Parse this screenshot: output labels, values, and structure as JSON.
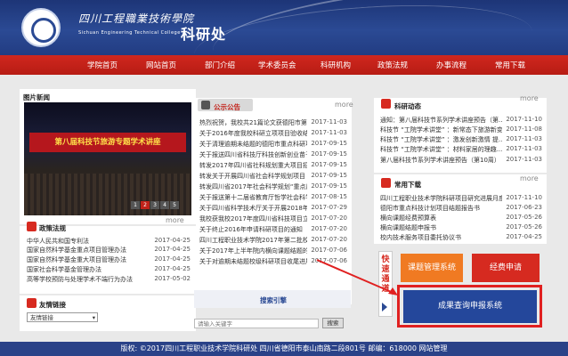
{
  "header": {
    "school_name_cn": "四川工程職業技術學院",
    "school_name_en": "Sichuan Engineering Technical College",
    "dept": "科研处"
  },
  "nav": [
    "学院首页",
    "网站首页",
    "部门介绍",
    "学术委员会",
    "科研机构",
    "政策法规",
    "办事流程",
    "常用下载"
  ],
  "photo_news": {
    "title": "图片新闻",
    "banner": "第八届科技节旅游专题学术讲座",
    "pages": [
      "1",
      "2",
      "3",
      "4",
      "5"
    ],
    "active_page": "2"
  },
  "policy": {
    "title": "政策法规",
    "more": "more",
    "items": [
      {
        "t": "中华人民共和国专利法",
        "d": "2017-04-25"
      },
      {
        "t": "国家自然科学基金重点项目管理办法",
        "d": "2017-04-25"
      },
      {
        "t": "国家自然科学基金重大项目管理办法",
        "d": "2017-04-25"
      },
      {
        "t": "国家社会科学基金管理办法",
        "d": "2017-04-25"
      },
      {
        "t": "高等学校预防与处理学术不端行为办法",
        "d": "2017-05-02"
      }
    ]
  },
  "links": {
    "title": "友情链接",
    "select_value": "友情链接"
  },
  "notice": {
    "title": "公示公告",
    "more": "more",
    "items": [
      {
        "t": "热烈祝贺，我校共21篇论文获德阳市第十六届...",
        "d": "2017-11-03"
      },
      {
        "t": "关于2016年度我校科研立项项目验收结题的通知",
        "d": "2017-11-03"
      },
      {
        "t": "关于清理逾期未结题的德阳市重点科研项目的通知",
        "d": "2017-09-15"
      },
      {
        "t": "关于报送四川省科技厅科技创新创业苗子工程项目",
        "d": "2017-09-15"
      },
      {
        "t": "转发2017年四川省社科规划重大项目招标公告",
        "d": "2017-09-15"
      },
      {
        "t": "转发关于开展四川省社会科学规划项目（首批...",
        "d": "2017-09-15"
      },
      {
        "t": "转发四川省2017年社会科学规划“重点后期资助...",
        "d": "2017-09-15"
      },
      {
        "t": "关于报送第十二届省教育厅哲学社会科学研究优...",
        "d": "2017-08-15"
      },
      {
        "t": "关于四川省科学技术厅关于开展2018年度科技项目",
        "d": "2017-07-29"
      },
      {
        "t": "我校获我校2017年度四川省科技项目立项通知",
        "d": "2017-07-20"
      },
      {
        "t": "关于终止2016年申请科研项目的通知",
        "d": "2017-07-20"
      },
      {
        "t": "四川工程职业技术学院2017年第二批校级科研项目",
        "d": "2017-07-20"
      },
      {
        "t": "关于2017年上半年院内横向课题结题的通知",
        "d": "2017-07-06"
      },
      {
        "t": "关于对逾期未结题校级科研项目收尾进展的通知",
        "d": "2017-07-06"
      }
    ]
  },
  "search": {
    "title": "搜索引擎",
    "placeholder": "请输入关键字",
    "button": "搜索"
  },
  "research": {
    "title": "科研动态",
    "more": "more",
    "items": [
      {
        "t": "通知：第八届科技节系列学术讲座预告（第...",
        "d": "2017-11-10"
      },
      {
        "t": "科技节 “工院学术讲堂” ：新常态下旅游新变...",
        "d": "2017-11-08"
      },
      {
        "t": "科技节 “工院学术讲堂” ：激发创新激情 提...",
        "d": "2017-11-03"
      },
      {
        "t": "科技节 “工院学术讲堂” ：材料家居的理趣...",
        "d": "2017-11-03"
      },
      {
        "t": "第八届科技节系列学术讲座预告（第10周）",
        "d": "2017-11-03"
      }
    ]
  },
  "downloads": {
    "title": "常用下载",
    "more": "more",
    "items": [
      {
        "t": "四川工程职业技术学院科研项目研究进展月度...",
        "d": "2017-11-10"
      },
      {
        "t": "德阳市重点科技计划项目结题报告书",
        "d": "2017-06-23"
      },
      {
        "t": "横向课题经费预算表",
        "d": "2017-05-26"
      },
      {
        "t": "横向课题结题申报书",
        "d": "2017-05-26"
      },
      {
        "t": "校内技术服务项目委托协议书",
        "d": "2017-04-25"
      }
    ]
  },
  "quick": {
    "label": "快速通道",
    "btn_course": "课题管理系统",
    "btn_budget": "经费申请",
    "btn_results": "成果查询申报系统"
  },
  "footer": {
    "text": "版权: ©2017四川工程职业技术学院科研处   四川省德阳市泰山南路二段801号   邮编：618000   网站管理"
  },
  "colors": {
    "header": "#24408a",
    "nav": "#c3221a",
    "course_btn": "#f07a22",
    "budget_btn": "#d62a20",
    "results_btn": "#24479b",
    "highlight": "#e02020"
  }
}
